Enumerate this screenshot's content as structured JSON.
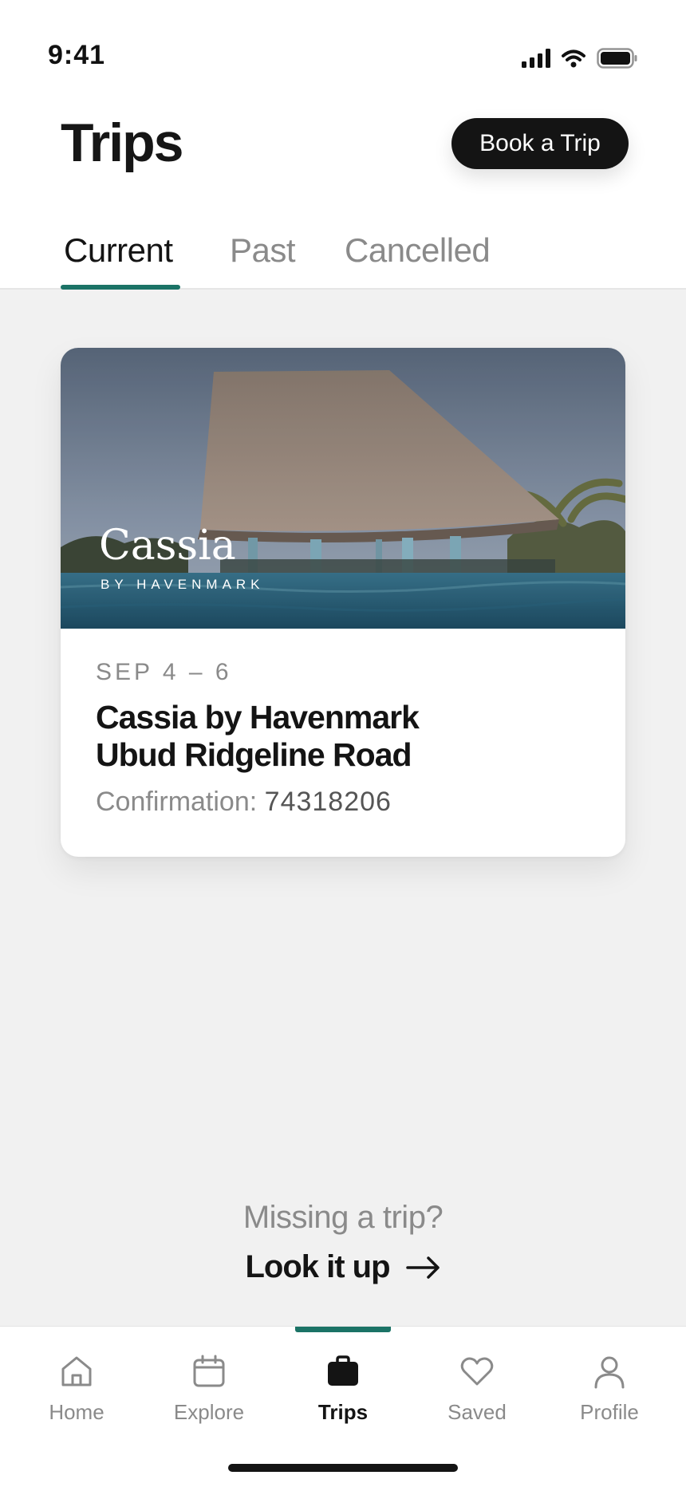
{
  "status": {
    "time": "9:41"
  },
  "header": {
    "title": "Trips",
    "book_label": "Book a Trip"
  },
  "tabs": [
    {
      "label": "Current",
      "active": true
    },
    {
      "label": "Past",
      "active": false
    },
    {
      "label": "Cancelled",
      "active": false
    }
  ],
  "trip": {
    "brand_name": "Cassia",
    "brand_sub": "BY HAVENMARK",
    "dates": "SEP 4 – 6",
    "name_line1": "Cassia by Havenmark",
    "name_line2": "Ubud Ridgeline Road",
    "confirmation_label": "Confirmation:",
    "confirmation_number": "74318206"
  },
  "missing": {
    "prompt": "Missing a trip?",
    "action": "Look it up"
  },
  "nav": [
    {
      "label": "Home",
      "icon": "home-icon"
    },
    {
      "label": "Explore",
      "icon": "calendar-icon"
    },
    {
      "label": "Trips",
      "icon": "briefcase-icon",
      "active": true
    },
    {
      "label": "Saved",
      "icon": "heart-icon"
    },
    {
      "label": "Profile",
      "icon": "person-icon"
    }
  ],
  "colors": {
    "accent": "#1b7366",
    "primary": "#141414",
    "muted": "#8a8a8a",
    "background": "#f1f1f1"
  }
}
